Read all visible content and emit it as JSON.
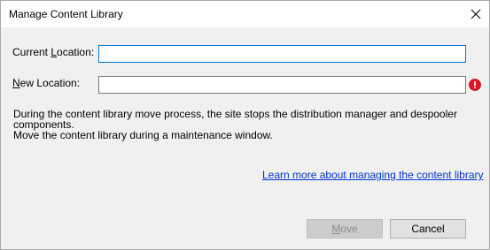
{
  "window": {
    "title": "Manage Content Library",
    "close_icon": "close-icon"
  },
  "form": {
    "current_location": {
      "label_pre": "Current ",
      "label_accel": "L",
      "label_post": "ocation:",
      "value": ""
    },
    "new_location": {
      "label_pre": "",
      "label_accel": "N",
      "label_post": "ew Location:",
      "value": "",
      "error_icon": "error-icon",
      "error_color": "#e81123"
    }
  },
  "info": {
    "line1": "During the content library move process, the site stops the distribution manager and despooler components.",
    "line2": "Move the content library during a maintenance window."
  },
  "link": {
    "text": "Learn more about managing the content library"
  },
  "buttons": {
    "move": {
      "accel": "M",
      "rest": "ove",
      "enabled": false
    },
    "cancel": {
      "label": "Cancel"
    }
  },
  "colors": {
    "accent": "#0078d7",
    "link": "#0033cc",
    "dialog_bg": "#f0f0f0"
  }
}
